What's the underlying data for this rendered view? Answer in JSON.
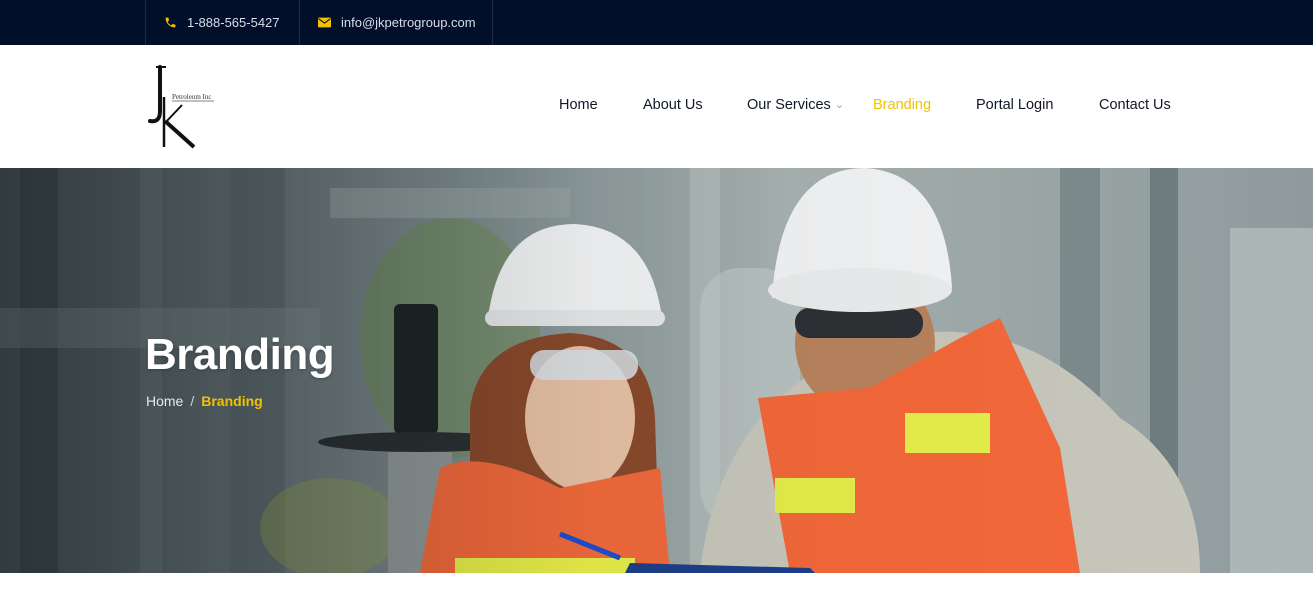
{
  "topbar": {
    "phone": "1-888-565-5427",
    "phone_icon": "phone-icon",
    "email": "info@jkpetrogroup.com",
    "email_icon": "envelope-icon"
  },
  "brand": {
    "logo_mark": "JK",
    "logo_subtext": "Petroleum Inc"
  },
  "nav": {
    "items": [
      {
        "label": "Home"
      },
      {
        "label": "About Us"
      },
      {
        "label": "Our Services",
        "has_dropdown": true
      },
      {
        "label": "Branding",
        "active": true
      },
      {
        "label": "Portal Login"
      },
      {
        "label": "Contact Us"
      }
    ]
  },
  "hero": {
    "title": "Branding",
    "breadcrumb": {
      "home": "Home",
      "separator": "/",
      "current": "Branding"
    }
  },
  "colors": {
    "topbar_bg": "#020f2b",
    "accent": "#f2c200",
    "nav_text": "#111827"
  }
}
